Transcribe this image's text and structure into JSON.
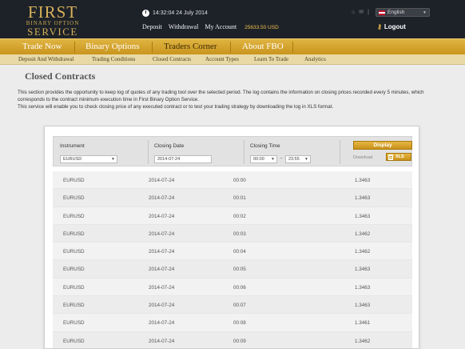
{
  "logo": {
    "line1": "FIRST",
    "line2": "BINARY OPTION",
    "line3": "SERVICE"
  },
  "header": {
    "datetime": "14:32:04 24 July 2014",
    "links": {
      "deposit": "Deposit",
      "withdrawal": "Withdrawal",
      "my_account": "My Account"
    },
    "balance": "25633.50 USD",
    "language": "English",
    "logout": "Logout"
  },
  "main_nav": {
    "items": [
      "Trade Now",
      "Binary Options",
      "Traders Corner",
      "About FBO"
    ],
    "active": "Traders Corner"
  },
  "sub_nav": {
    "items": [
      "Deposit And Withdrawal",
      "Trading Conditions",
      "Closed Contracts",
      "Account Types",
      "Learn To Trade",
      "Analytics"
    ]
  },
  "page": {
    "title": "Closed Contracts",
    "description1": "This section provides the opportunity to keep log of quotes of any trading tool over the selected period. The log contains the information on closing prices recorded every 5 minutes, which corresponds to the contract minimum execution time in First Binary Option Service.",
    "description2": "This service will enable you to check closing price of any executed contract or to test your trading strategy by downloading the log in XLS format."
  },
  "filter": {
    "instrument_label": "Instrument",
    "instrument_value": "EURUSD",
    "closing_date_label": "Closing Date",
    "closing_date_value": "2014-07-24",
    "closing_time_label": "Closing Time",
    "time_from": "00:00",
    "time_separator": "-",
    "time_to": "23:55",
    "display_button": "Display",
    "download_label": "Download",
    "xls_button": "XLS"
  },
  "table": {
    "rows": [
      [
        "EURUSD",
        "2014-07-24",
        "00:00",
        "1.3463"
      ],
      [
        "EURUSD",
        "2014-07-24",
        "00:01",
        "1.3463"
      ],
      [
        "EURUSD",
        "2014-07-24",
        "00:02",
        "1.3463"
      ],
      [
        "EURUSD",
        "2014-07-24",
        "00:03",
        "1.3462"
      ],
      [
        "EURUSD",
        "2014-07-24",
        "00:04",
        "1.3462"
      ],
      [
        "EURUSD",
        "2014-07-24",
        "00:05",
        "1.3463"
      ],
      [
        "EURUSD",
        "2014-07-24",
        "00:06",
        "1.3463"
      ],
      [
        "EURUSD",
        "2014-07-24",
        "00:07",
        "1.3463"
      ],
      [
        "EURUSD",
        "2014-07-24",
        "00:08",
        "1.3461"
      ],
      [
        "EURUSD",
        "2014-07-24",
        "00:09",
        "1.3462"
      ]
    ]
  }
}
